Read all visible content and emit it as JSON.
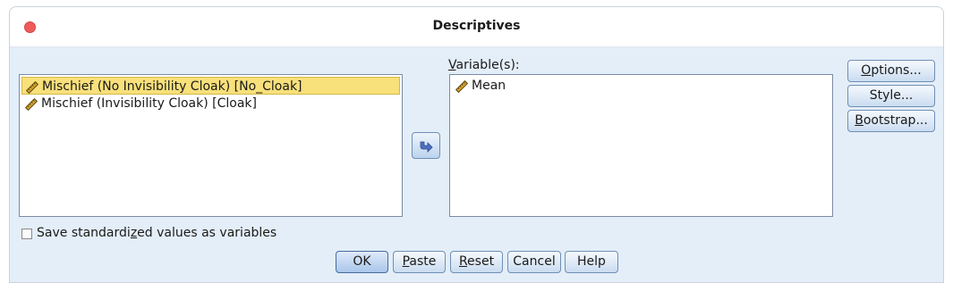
{
  "window": {
    "title": "Descriptives"
  },
  "source_list": {
    "items": [
      {
        "label": "Mischief (No Invisibility Cloak) [No_Cloak]",
        "selected": true,
        "icon": "scale-ruler-icon"
      },
      {
        "label": "Mischief (Invisibility Cloak) [Cloak]",
        "selected": false,
        "icon": "scale-ruler-icon"
      }
    ]
  },
  "target": {
    "label_underlined": "V",
    "label_rest": "ariable(s):",
    "items": [
      {
        "label": "Mean",
        "icon": "scale-ruler-icon"
      }
    ]
  },
  "side_buttons": {
    "options": {
      "u": "O",
      "rest": "ptions..."
    },
    "style": {
      "label": "Style..."
    },
    "bootstrap": {
      "u": "B",
      "rest": "ootstrap..."
    }
  },
  "checkbox": {
    "label_before": "Save standardi",
    "label_u": "z",
    "label_after": "ed values as variables",
    "checked": false
  },
  "bottom_buttons": {
    "ok": "OK",
    "paste": {
      "u": "P",
      "rest": "aste"
    },
    "reset": {
      "u": "R",
      "rest": "eset"
    },
    "cancel": "Cancel",
    "help": "Help"
  },
  "colors": {
    "selection": "#f8e07a",
    "close": "#ef5b5b",
    "panel": "#e4eef8"
  }
}
